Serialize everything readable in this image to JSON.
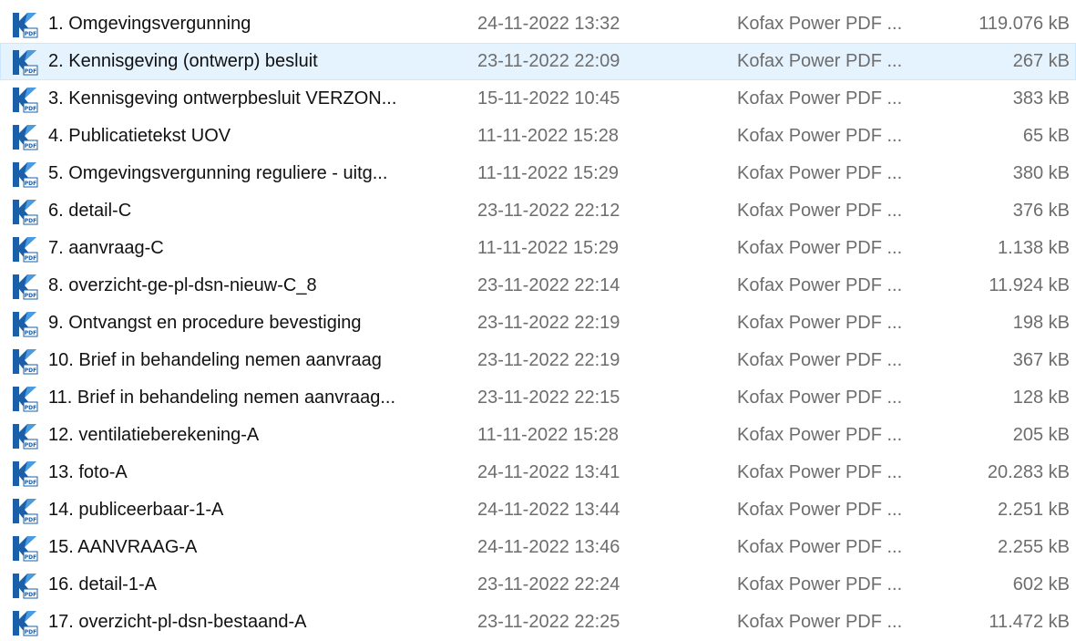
{
  "files": [
    {
      "name": "1. Omgevingsvergunning",
      "date": "24-11-2022 13:32",
      "type": "Kofax Power PDF ...",
      "size": "119.076 kB",
      "icon": "kofax-pdf-icon"
    },
    {
      "name": "2. Kennisgeving (ontwerp) besluit",
      "date": "23-11-2022 22:09",
      "type": "Kofax Power PDF ...",
      "size": "267 kB",
      "icon": "kofax-pdf-icon",
      "selected": true
    },
    {
      "name": "3. Kennisgeving ontwerpbesluit VERZON...",
      "date": "15-11-2022 10:45",
      "type": "Kofax Power PDF ...",
      "size": "383 kB",
      "icon": "kofax-pdf-icon"
    },
    {
      "name": "4. Publicatietekst UOV",
      "date": "11-11-2022 15:28",
      "type": "Kofax Power PDF ...",
      "size": "65 kB",
      "icon": "kofax-pdf-icon"
    },
    {
      "name": "5. Omgevingsvergunning reguliere - uitg...",
      "date": "11-11-2022 15:29",
      "type": "Kofax Power PDF ...",
      "size": "380 kB",
      "icon": "kofax-pdf-icon"
    },
    {
      "name": "6. detail-C",
      "date": "23-11-2022 22:12",
      "type": "Kofax Power PDF ...",
      "size": "376 kB",
      "icon": "kofax-pdf-icon"
    },
    {
      "name": "7. aanvraag-C",
      "date": "11-11-2022 15:29",
      "type": "Kofax Power PDF ...",
      "size": "1.138 kB",
      "icon": "kofax-pdf-icon"
    },
    {
      "name": "8. overzicht-ge-pl-dsn-nieuw-C_8",
      "date": "23-11-2022 22:14",
      "type": "Kofax Power PDF ...",
      "size": "11.924 kB",
      "icon": "kofax-pdf-icon"
    },
    {
      "name": "9. Ontvangst en procedure bevestiging",
      "date": "23-11-2022 22:19",
      "type": "Kofax Power PDF ...",
      "size": "198 kB",
      "icon": "kofax-pdf-icon"
    },
    {
      "name": "10. Brief in behandeling nemen aanvraag",
      "date": "23-11-2022 22:19",
      "type": "Kofax Power PDF ...",
      "size": "367 kB",
      "icon": "kofax-pdf-icon"
    },
    {
      "name": "11. Brief in behandeling nemen aanvraag...",
      "date": "23-11-2022 22:15",
      "type": "Kofax Power PDF ...",
      "size": "128 kB",
      "icon": "kofax-pdf-icon"
    },
    {
      "name": "12. ventilatieberekening-A",
      "date": "11-11-2022 15:28",
      "type": "Kofax Power PDF ...",
      "size": "205 kB",
      "icon": "kofax-pdf-icon"
    },
    {
      "name": "13. foto-A",
      "date": "24-11-2022 13:41",
      "type": "Kofax Power PDF ...",
      "size": "20.283 kB",
      "icon": "kofax-pdf-icon"
    },
    {
      "name": "14. publiceerbaar-1-A",
      "date": "24-11-2022 13:44",
      "type": "Kofax Power PDF ...",
      "size": "2.251 kB",
      "icon": "kofax-pdf-icon"
    },
    {
      "name": "15. AANVRAAG-A",
      "date": "24-11-2022 13:46",
      "type": "Kofax Power PDF ...",
      "size": "2.255 kB",
      "icon": "kofax-pdf-icon"
    },
    {
      "name": "16. detail-1-A",
      "date": "23-11-2022 22:24",
      "type": "Kofax Power PDF ...",
      "size": "602 kB",
      "icon": "kofax-pdf-icon"
    },
    {
      "name": "17. overzicht-pl-dsn-bestaand-A",
      "date": "23-11-2022 22:25",
      "type": "Kofax Power PDF ...",
      "size": "11.472 kB",
      "icon": "kofax-pdf-icon"
    }
  ],
  "colors": {
    "selected_row": "#e5f3ff",
    "icon_blue": "#1a5fa8",
    "icon_light": "#4a9be0"
  }
}
